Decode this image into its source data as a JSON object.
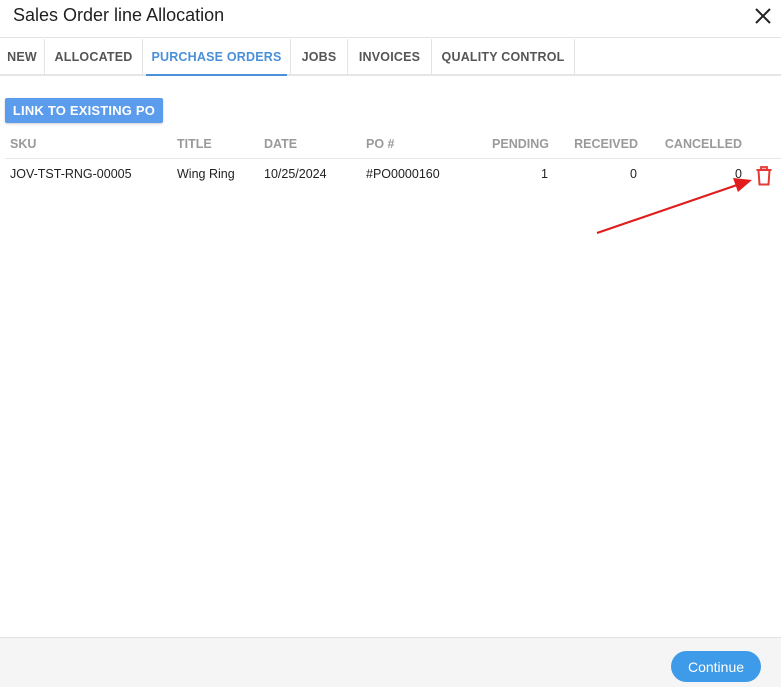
{
  "dialog": {
    "title": "Sales Order line Allocation"
  },
  "tabs": [
    {
      "label": "NEW"
    },
    {
      "label": "ALLOCATED"
    },
    {
      "label": "PURCHASE ORDERS"
    },
    {
      "label": "JOBS"
    },
    {
      "label": "INVOICES"
    },
    {
      "label": "QUALITY CONTROL"
    }
  ],
  "active_tab": "PURCHASE ORDERS",
  "toolbar": {
    "link_label": "LINK TO EXISTING PO"
  },
  "table": {
    "columns": [
      "SKU",
      "TITLE",
      "DATE",
      "PO #",
      "PENDING",
      "RECEIVED",
      "CANCELLED"
    ],
    "rows": [
      {
        "sku": "JOV-TST-RNG-00005",
        "title": "Wing Ring",
        "date": "10/25/2024",
        "po": "#PO0000160",
        "pending": "1",
        "received": "0",
        "cancelled": "0"
      }
    ]
  },
  "footer": {
    "continue_label": "Continue"
  },
  "colors": {
    "accent": "#4a90d9",
    "button": "#5b9cec",
    "delete": "#e53935",
    "annotation_arrow": "#e01c1c"
  },
  "icons": {
    "close": "close-icon",
    "delete": "trash-icon",
    "annotation": "arrow-annotation"
  }
}
